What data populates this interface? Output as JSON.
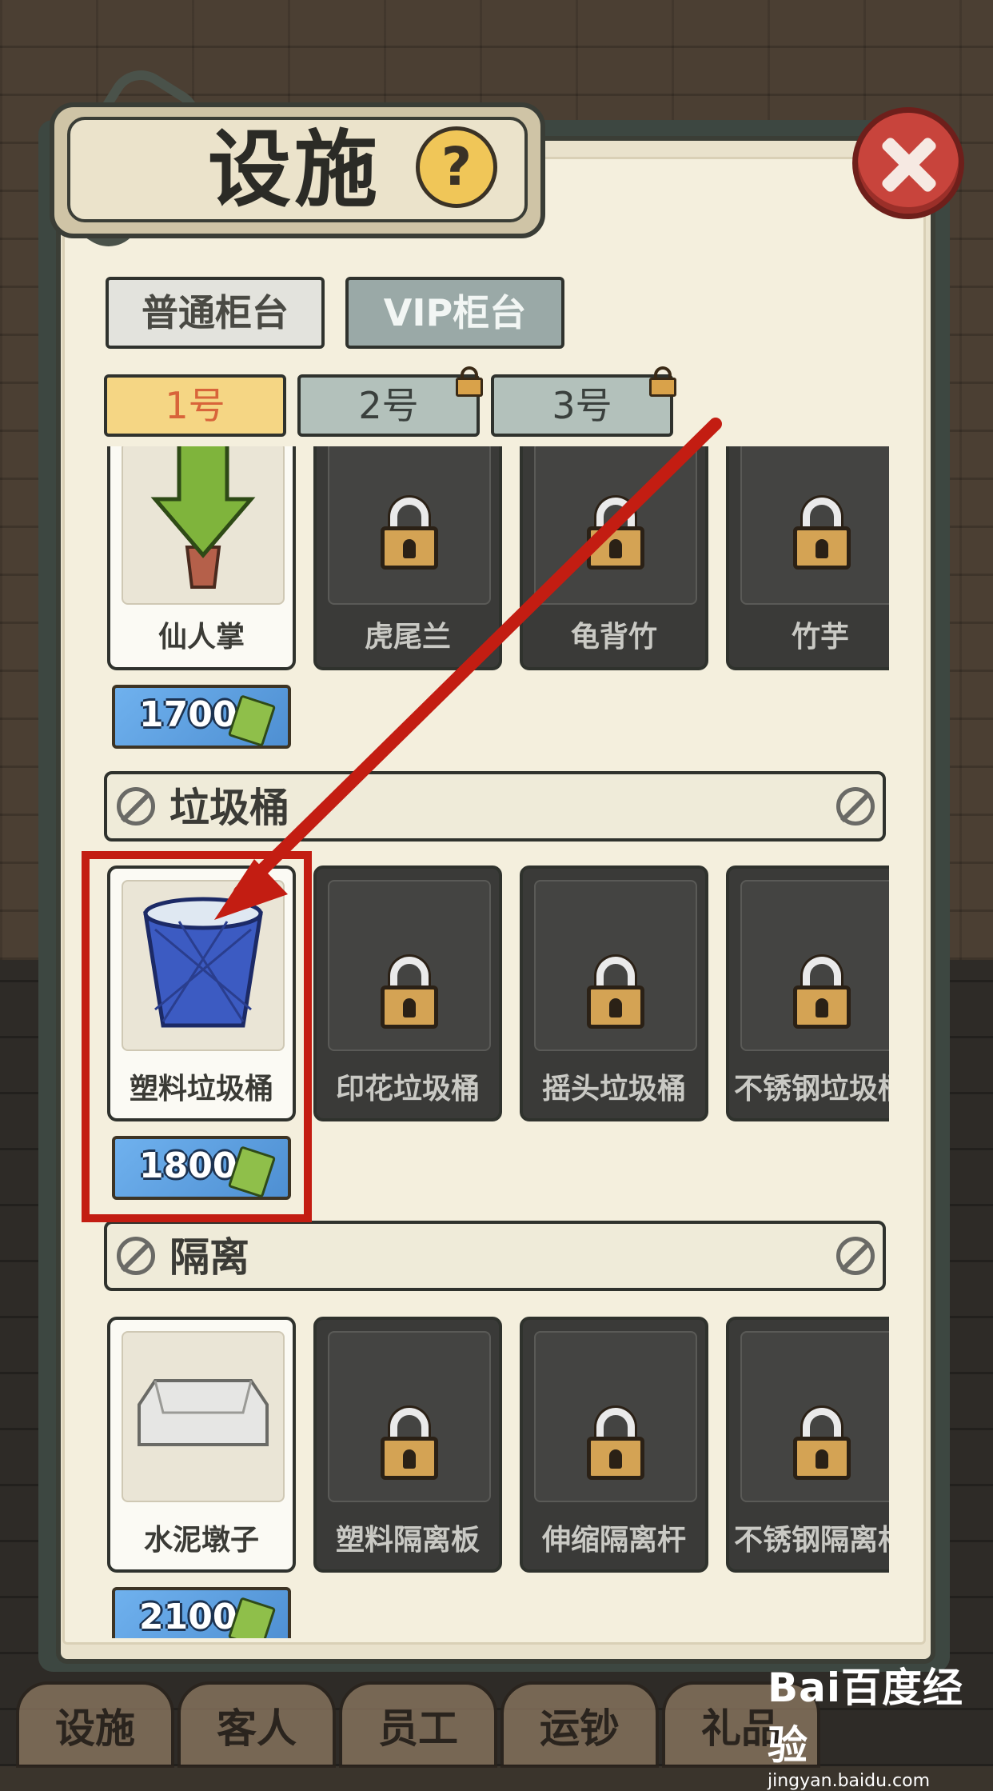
{
  "dialog": {
    "title": "设施",
    "help_glyph": "?",
    "close_icon": "close-icon"
  },
  "counter_tabs": [
    {
      "label": "普通柜台",
      "selected": false
    },
    {
      "label": "VIP柜台",
      "selected": true
    }
  ],
  "counter_numbers": [
    {
      "label": "1号",
      "selected": true,
      "locked": false
    },
    {
      "label": "2号",
      "selected": false,
      "locked": true
    },
    {
      "label": "3号",
      "selected": false,
      "locked": true
    }
  ],
  "plants": {
    "items": [
      {
        "name": "仙人掌",
        "owned": true
      },
      {
        "name": "虎尾兰",
        "owned": false
      },
      {
        "name": "龟背竹",
        "owned": false
      },
      {
        "name": "竹芋",
        "owned": false
      }
    ],
    "price": "1700"
  },
  "trash": {
    "title": "垃圾桶",
    "items": [
      {
        "name": "塑料垃圾桶",
        "owned": true
      },
      {
        "name": "印花垃圾桶",
        "owned": false
      },
      {
        "name": "摇头垃圾桶",
        "owned": false
      },
      {
        "name": "不锈钢垃圾桶",
        "owned": false
      }
    ],
    "price": "1800"
  },
  "barrier": {
    "title": "隔离",
    "items": [
      {
        "name": "水泥墩子",
        "owned": true
      },
      {
        "name": "塑料隔离板",
        "owned": false
      },
      {
        "name": "伸缩隔离杆",
        "owned": false
      },
      {
        "name": "不锈钢隔离杆",
        "owned": false
      }
    ],
    "price": "2100"
  },
  "bottom_nav": [
    "设施",
    "客人",
    "员工",
    "运钞",
    "礼品"
  ],
  "watermark": {
    "logo": "Bai百度经验",
    "url": "jingyan.baidu.com"
  },
  "colors": {
    "accent_red": "#c31d12",
    "price_blue": "#5b9fe0",
    "selected_tab": "#f5d684"
  }
}
